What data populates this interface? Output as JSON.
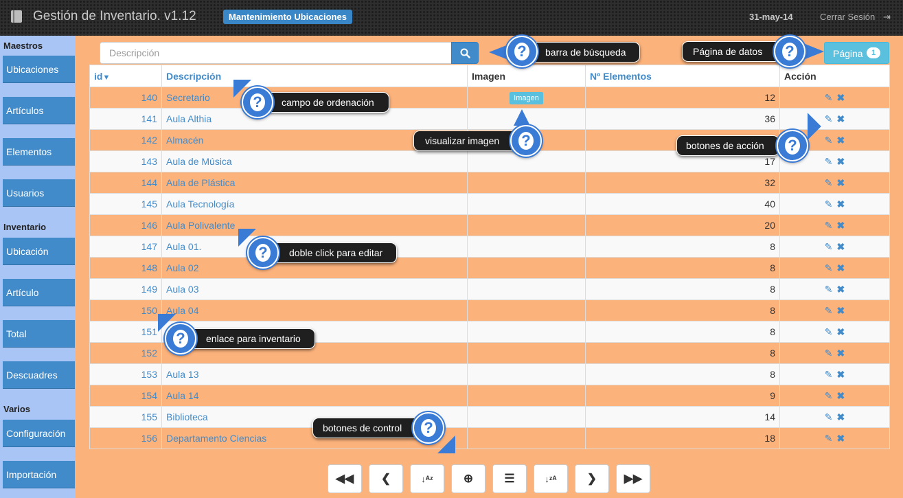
{
  "header": {
    "app_title": "Gestión de Inventario. v1.12",
    "module": "Mantenimiento Ubicaciones",
    "date": "31-may-14",
    "logout": "Cerrar Sesión"
  },
  "sidebar": {
    "sections": [
      {
        "title": "Maestros",
        "items": [
          "Ubicaciones",
          "Artículos",
          "Elementos",
          "Usuarios"
        ]
      },
      {
        "title": "Inventario",
        "items": [
          "Ubicación",
          "Artículo",
          "Total",
          "Descuadres"
        ]
      },
      {
        "title": "Varios",
        "items": [
          "Configuración",
          "Importación"
        ]
      }
    ]
  },
  "search": {
    "placeholder": "Descripción"
  },
  "pagination": {
    "label": "Página",
    "current": "1"
  },
  "table": {
    "columns": {
      "id": "id",
      "description": "Descripción",
      "image": "Imagen",
      "elements": "Nº Elementos",
      "action": "Acción"
    },
    "image_button": "Imagen",
    "rows": [
      {
        "id": "140",
        "description": "Secretario",
        "image": true,
        "elements": "12"
      },
      {
        "id": "141",
        "description": "Aula Althia",
        "image": false,
        "elements": "36"
      },
      {
        "id": "142",
        "description": "Almacén",
        "image": false,
        "elements": ""
      },
      {
        "id": "143",
        "description": "Aula de Música",
        "image": false,
        "elements": "17"
      },
      {
        "id": "144",
        "description": "Aula de Plástica",
        "image": false,
        "elements": "32"
      },
      {
        "id": "145",
        "description": "Aula Tecnología",
        "image": false,
        "elements": "40"
      },
      {
        "id": "146",
        "description": "Aula Polivalente",
        "image": false,
        "elements": "20"
      },
      {
        "id": "147",
        "description": "Aula 01.",
        "image": false,
        "elements": "8"
      },
      {
        "id": "148",
        "description": "Aula 02",
        "image": false,
        "elements": "8"
      },
      {
        "id": "149",
        "description": "Aula 03",
        "image": false,
        "elements": "8"
      },
      {
        "id": "150",
        "description": "Aula 04",
        "image": false,
        "elements": "8"
      },
      {
        "id": "151",
        "description": "",
        "image": false,
        "elements": "8"
      },
      {
        "id": "152",
        "description": "",
        "image": false,
        "elements": "8"
      },
      {
        "id": "153",
        "description": "Aula 13",
        "image": false,
        "elements": "8"
      },
      {
        "id": "154",
        "description": "Aula 14",
        "image": false,
        "elements": "9"
      },
      {
        "id": "155",
        "description": "Biblioteca",
        "image": false,
        "elements": "14"
      },
      {
        "id": "156",
        "description": "Departamento Ciencias",
        "image": false,
        "elements": "18"
      }
    ]
  },
  "controls": [
    "first-page",
    "previous-page",
    "sort-ascending",
    "add",
    "list",
    "sort-descending",
    "next-page",
    "last-page"
  ],
  "tips": {
    "search_bar": "barra de búsqueda",
    "data_page": "Página de datos",
    "sort_field": "campo de ordenación",
    "view_image": "visualizar imagen",
    "action_buttons": "botones de acción",
    "double_click": "doble click para editar",
    "inventory_link": "enlace para inventario",
    "control_buttons": "botones de control"
  },
  "colors": {
    "accent": "#428bca",
    "row_highlight": "#fcb27b",
    "sidebar": "#a9c5f6",
    "help": "#3a7bd5"
  }
}
